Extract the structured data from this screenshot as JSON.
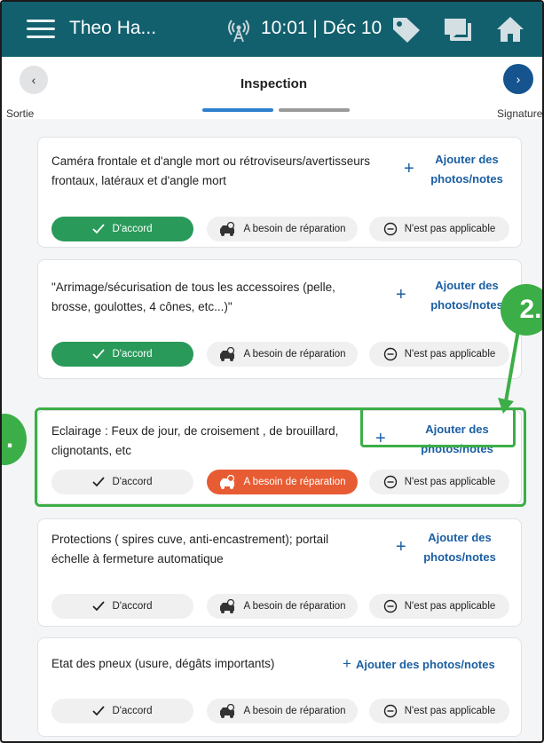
{
  "appbar": {
    "user_name": "Theo Ha...",
    "time_date": "10:01 | Déc 10"
  },
  "subhead": {
    "title": "Inspection",
    "back_label": "Sortie",
    "next_label": "Signature",
    "back_glyph": "‹",
    "next_glyph": "›"
  },
  "labels": {
    "ok": "D'accord",
    "repair": "A besoin de réparation",
    "na": "N'est pas applicable",
    "add_line1": "Ajouter des",
    "add_line2": "photos/notes",
    "add_single": "Ajouter des photos/notes",
    "plus": "+"
  },
  "items": [
    {
      "line1": "Caméra frontale et d'angle mort ou rétroviseurs/avertisseurs",
      "line2": "frontaux, latéraux et d'angle mort",
      "status": "ok"
    },
    {
      "line1": "\"Arrimage/sécurisation de tous les accessoires (pelle,",
      "line2": "brosse, goulottes, 4 cônes, etc...)\"",
      "status": "ok"
    },
    {
      "line1": "Eclairage : Feux de jour, de croisement , de brouillard,",
      "line2": "clignotants, etc",
      "status": "repair"
    },
    {
      "line1": "Protections ( spires cuve, anti-encastrement); portail",
      "line2": "échelle à fermeture automatique",
      "status": "none"
    },
    {
      "line1": "Etat des pneux (usure, dégâts importants)",
      "line2": "",
      "status": "none"
    }
  ],
  "annotations": {
    "badge_1": ".",
    "badge_2": "2."
  },
  "colors": {
    "appbar": "#12606e",
    "accent_blue": "#1b5fa3",
    "ok_green": "#2a9a5a",
    "repair_orange": "#e85c33",
    "annotation_green": "#3cae47"
  }
}
